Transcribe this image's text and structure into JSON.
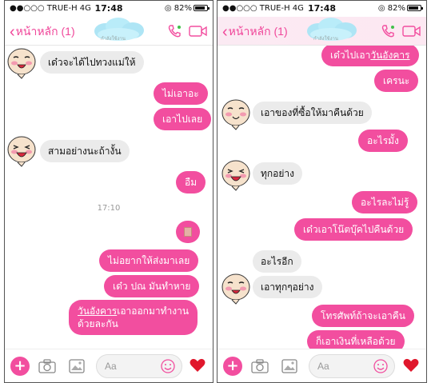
{
  "status_bar": {
    "carrier": "●●○○○ TRUE-H  4G",
    "time": "17:48",
    "battery": "82%"
  },
  "nav": {
    "back_label": "หน้าหลัก (1)",
    "subtitle": "กำลังใช้งาน"
  },
  "left_chat": {
    "messages": [
      {
        "dir": "in",
        "text": "เด๋วจะได้ไปทวงแม่ให้"
      },
      {
        "dir": "out",
        "text": "ไม่เอาอะ"
      },
      {
        "dir": "out",
        "text": "เอาไปเลย"
      },
      {
        "dir": "in",
        "text": "สามอย่างนะถ้างั้น"
      },
      {
        "dir": "out",
        "text": "อืม"
      },
      {
        "dir": "out",
        "text": "ไม่อยากให้ส่งมาเลย"
      },
      {
        "dir": "out",
        "text": "เด๋ว ปณ มันทำหาย"
      },
      {
        "dir": "out",
        "text": "วันอังคารเอาออกมาทำงาน"
      },
      {
        "dir": "out",
        "text": "ด้วยละกัน"
      }
    ],
    "timestamp": "17:10"
  },
  "right_chat": {
    "messages": [
      {
        "dir": "out",
        "text": "เด๋วไปเอาวันอังคาร"
      },
      {
        "dir": "out",
        "text": "เครนะ"
      },
      {
        "dir": "in",
        "text": "เอาของที่ซื้อให้มาคืนด้วย"
      },
      {
        "dir": "out",
        "text": "อะไรมั้ง"
      },
      {
        "dir": "in",
        "text": "ทุกอย่าง"
      },
      {
        "dir": "out",
        "text": "อะไรละไม่รู้"
      },
      {
        "dir": "out",
        "text": "เด๋วเอาโน๊ตบุ๊คไปคืนด้วย"
      },
      {
        "dir": "in",
        "text": "อะไรอีก"
      },
      {
        "dir": "in",
        "text": "เอาทุกๆอย่าง"
      },
      {
        "dir": "out",
        "text": "โทรศัพท์ถ้าจะเอาคืน"
      },
      {
        "dir": "out",
        "text": "ก็เอาเงินที่เหลือด้วย"
      }
    ]
  },
  "composer": {
    "placeholder": "Aa"
  },
  "colors": {
    "accent": "#f24e9f",
    "incoming": "#ebebeb"
  },
  "icons": [
    "chevron-left-icon",
    "cloud-logo",
    "phone-icon",
    "video-icon",
    "plus-icon",
    "camera-icon",
    "image-icon",
    "emoji-icon",
    "heart-icon",
    "avatar-sticker"
  ]
}
